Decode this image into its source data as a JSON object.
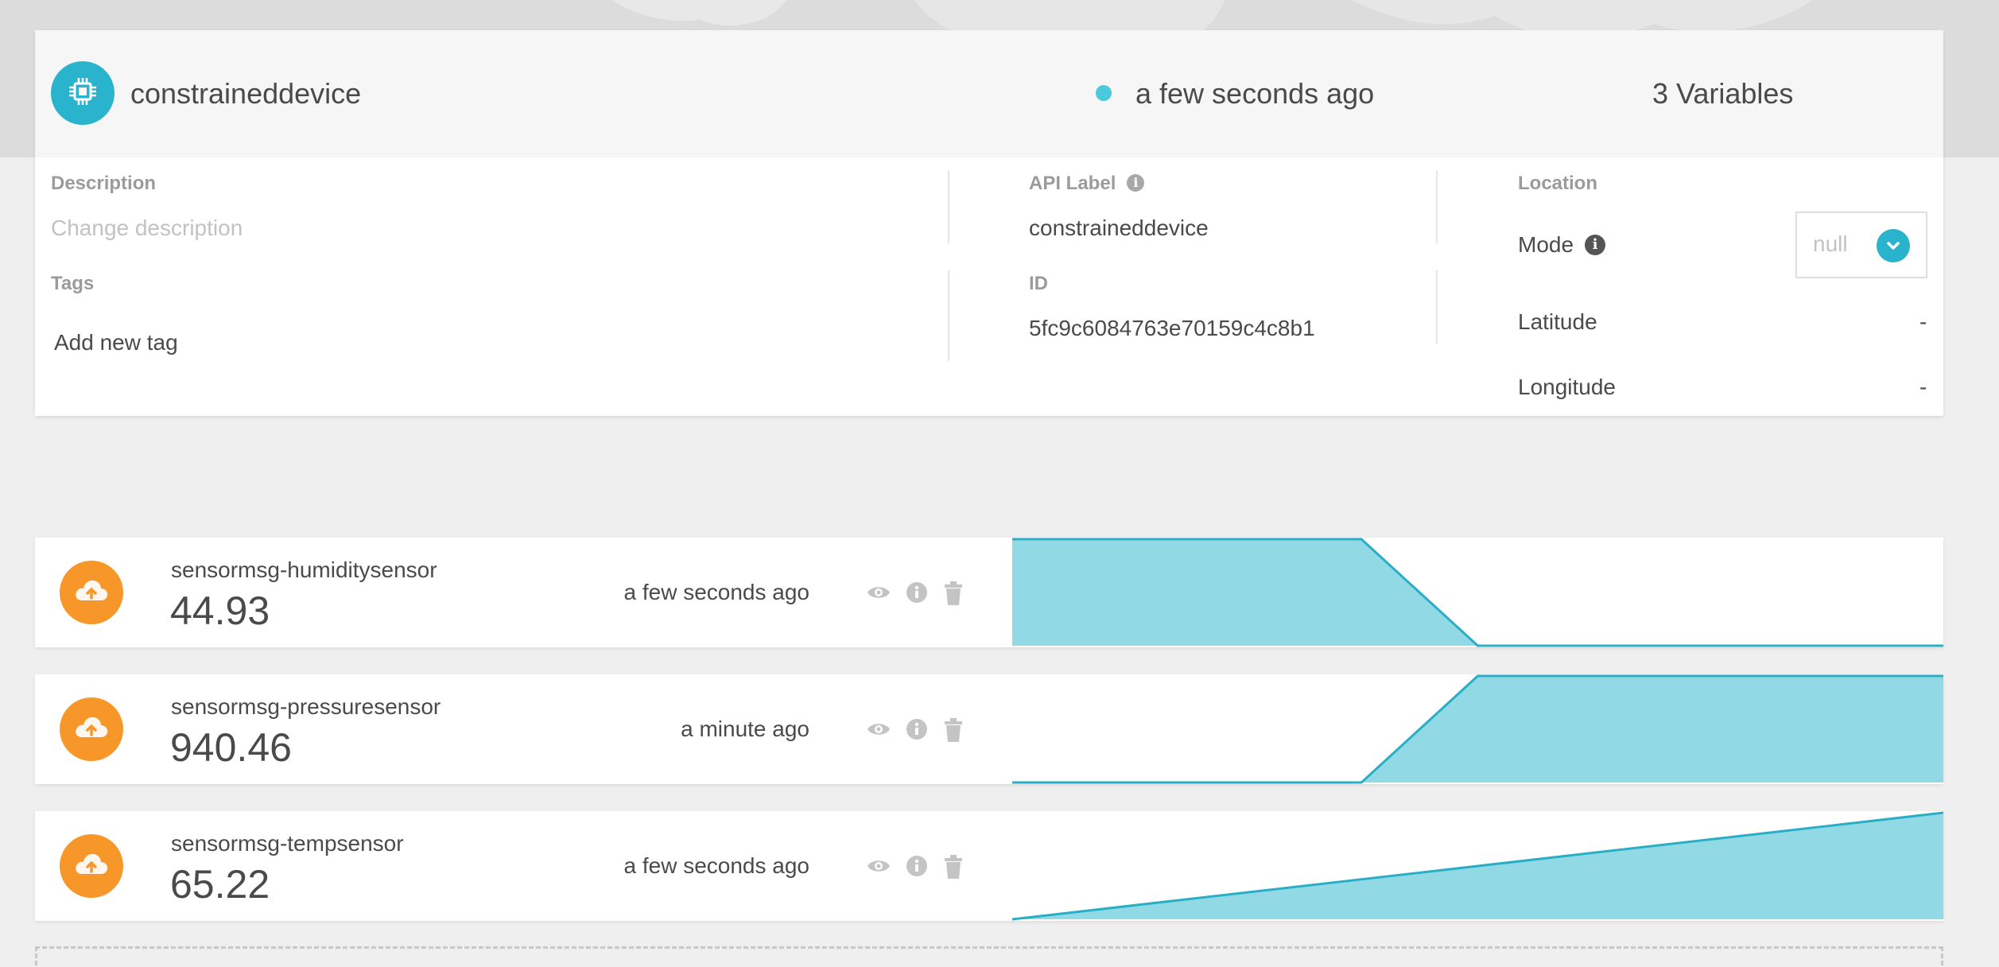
{
  "device": {
    "name": "constraineddevice",
    "last_activity": "a few seconds ago",
    "variables_count": "3 Variables",
    "description_label": "Description",
    "description_placeholder": "Change description",
    "tags_label": "Tags",
    "add_tag_label": "Add new tag",
    "api_label_title": "API Label",
    "api_label_value": "constraineddevice",
    "id_title": "ID",
    "id_value": "5fc9c6084763e70159c4c8b1",
    "location_title": "Location",
    "mode_label": "Mode",
    "mode_value": "null",
    "latitude_label": "Latitude",
    "latitude_value": "-",
    "longitude_label": "Longitude",
    "longitude_value": "-"
  },
  "icons": {
    "device": "chip-icon",
    "variable": "cloud-upload-icon",
    "view": "eye-icon",
    "info": "info-icon",
    "delete": "trash-icon",
    "dropdown": "chevron-down-icon"
  },
  "colors": {
    "accent": "#29b3cc",
    "status_dot": "#4cc9dd",
    "variable_icon": "#f7972a",
    "sparkline_fill": "#90d9e5",
    "sparkline_stroke": "#2aaec5"
  },
  "variables": [
    {
      "name": "sensormsg-humiditysensor",
      "value": "44.93",
      "time": "a few seconds ago",
      "sparkline": [
        1.0,
        1.0,
        1.0,
        1.0,
        0.0,
        0.0,
        0.0,
        0.0,
        0.0
      ]
    },
    {
      "name": "sensormsg-pressuresensor",
      "value": "940.46",
      "time": "a minute ago",
      "sparkline": [
        0.0,
        0.0,
        0.0,
        0.0,
        1.0,
        1.0,
        1.0,
        1.0,
        1.0
      ]
    },
    {
      "name": "sensormsg-tempsensor",
      "value": "65.22",
      "time": "a few seconds ago",
      "sparkline": [
        0.0,
        1.0
      ]
    }
  ]
}
